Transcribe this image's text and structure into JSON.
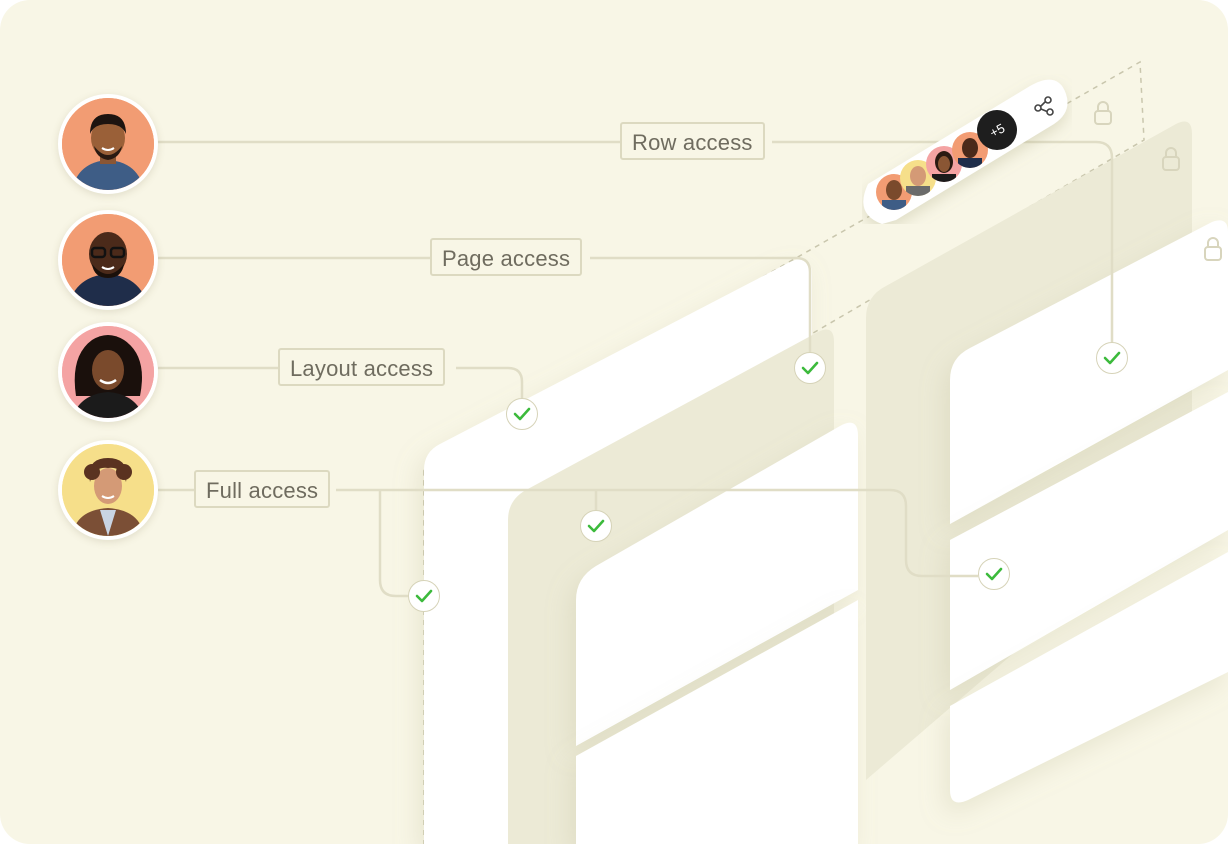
{
  "access_levels": [
    {
      "label": "Row access",
      "avatar": "person-1",
      "avatar_bg": "#f29c73"
    },
    {
      "label": "Page access",
      "avatar": "person-2",
      "avatar_bg": "#f29c73"
    },
    {
      "label": "Layout access",
      "avatar": "person-3",
      "avatar_bg": "#f4a3a3"
    },
    {
      "label": "Full access",
      "avatar": "person-4",
      "avatar_bg": "#f6df8a"
    }
  ],
  "shared_group": {
    "more_count": "+5",
    "share_icon": "share-icon"
  },
  "icons": {
    "check": "check-icon",
    "lock": "lock-icon"
  },
  "colors": {
    "background": "#f8f6e6",
    "connector": "#e0ddc6",
    "check_green": "#3cba3c",
    "panel": "#ffffff",
    "back_panel": "#ecead6"
  }
}
